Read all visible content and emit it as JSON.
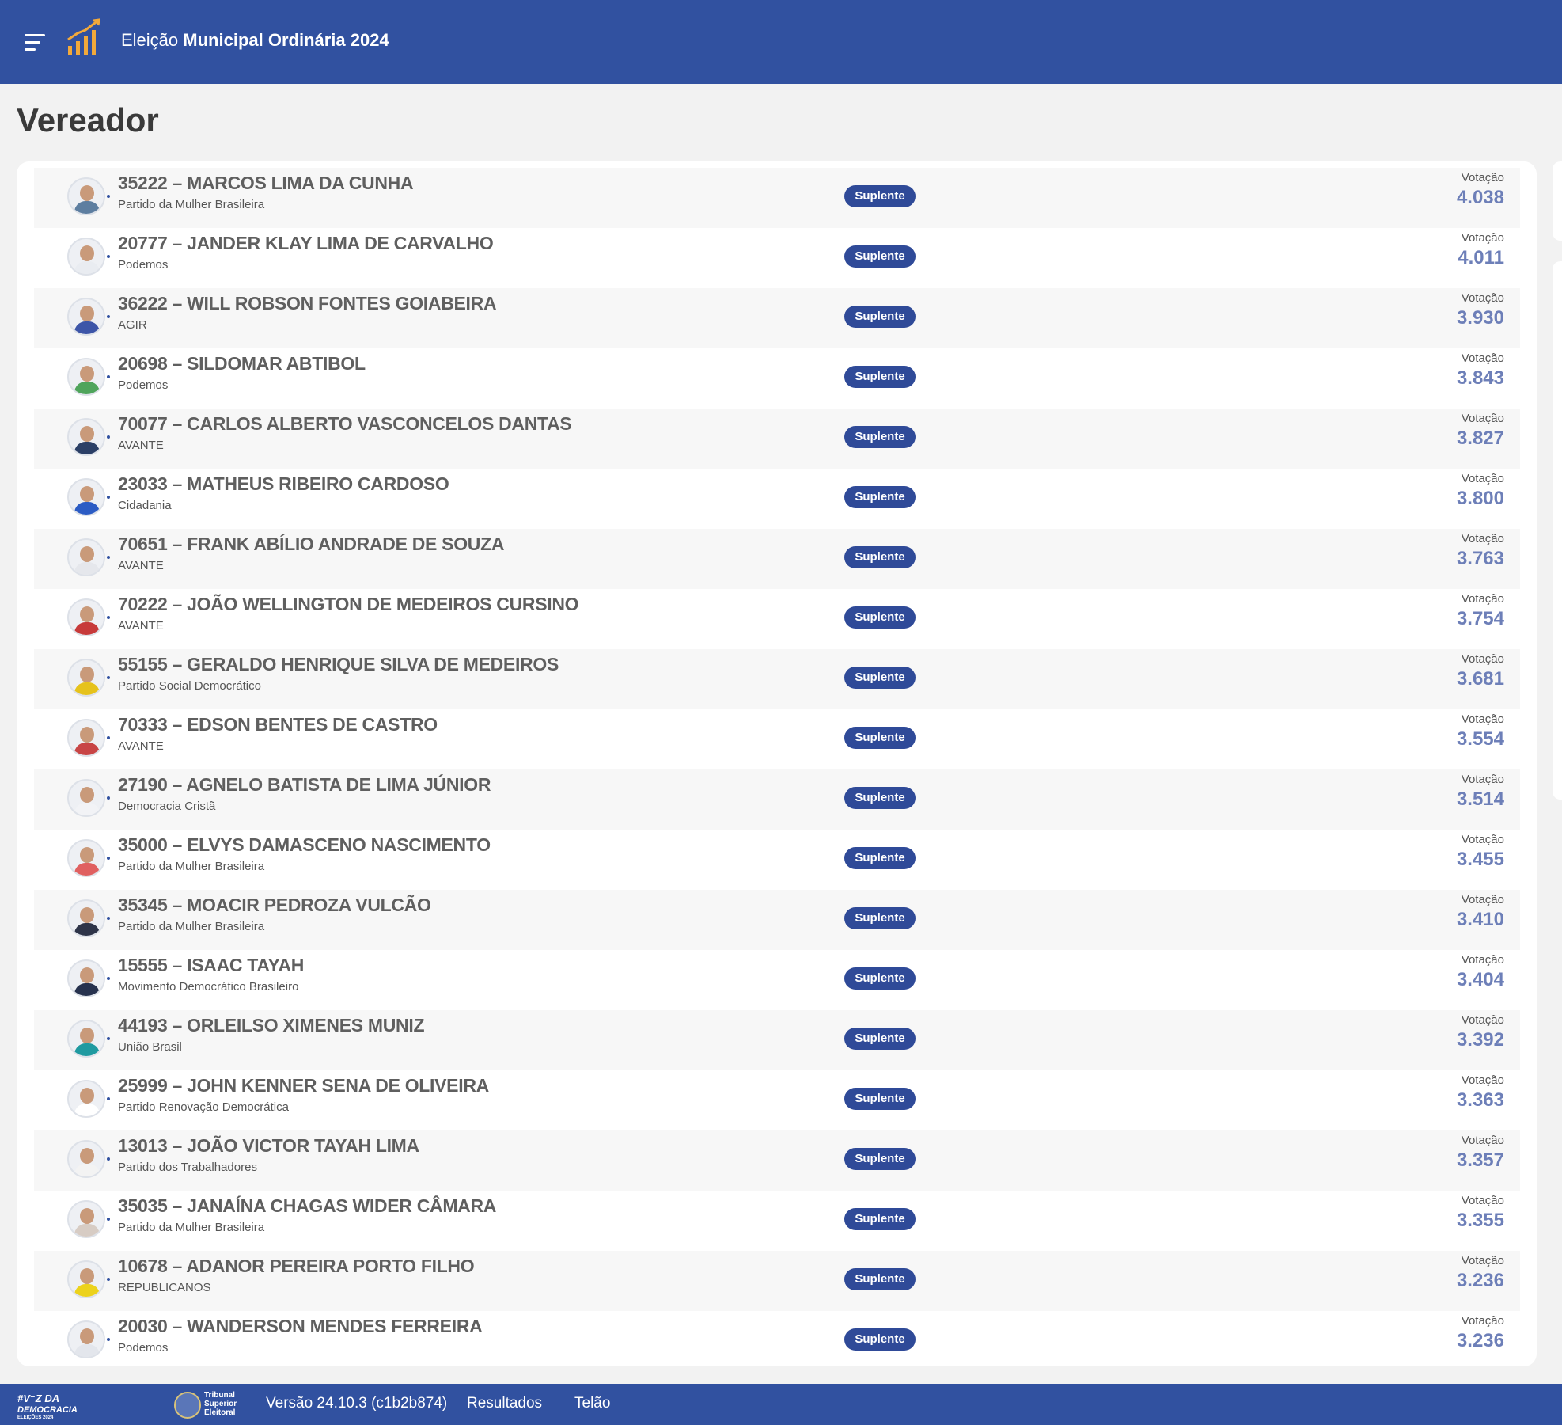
{
  "header": {
    "title_prefix": "Eleição ",
    "title_bold": "Municipal Ordinária 2024"
  },
  "page": {
    "title": "Vereador"
  },
  "vote_label": "Votação",
  "status_label": "Suplente",
  "candidates": [
    {
      "name": "35222 – MARCOS LIMA DA CUNHA",
      "party": "Partido da Mulher Brasileira",
      "votes": "4.038",
      "shirt": "#5d7ea0"
    },
    {
      "name": "20777 – JANDER KLAY LIMA DE CARVALHO",
      "party": "Podemos",
      "votes": "4.011",
      "shirt": "#e9ecf1"
    },
    {
      "name": "36222 – WILL ROBSON FONTES GOIABEIRA",
      "party": "AGIR",
      "votes": "3.930",
      "shirt": "#3d55a8"
    },
    {
      "name": "20698 – SILDOMAR ABTIBOL",
      "party": "Podemos",
      "votes": "3.843",
      "shirt": "#4fa45b"
    },
    {
      "name": "70077 – CARLOS ALBERTO VASCONCELOS DANTAS",
      "party": "AVANTE",
      "votes": "3.827",
      "shirt": "#2b3f66"
    },
    {
      "name": "23033 – MATHEUS RIBEIRO CARDOSO",
      "party": "Cidadania",
      "votes": "3.800",
      "shirt": "#2c5cc4"
    },
    {
      "name": "70651 – FRANK ABÍLIO ANDRADE DE SOUZA",
      "party": "AVANTE",
      "votes": "3.763",
      "shirt": "#e5e7ec"
    },
    {
      "name": "70222 – JOÃO WELLINGTON DE MEDEIROS CURSINO",
      "party": "AVANTE",
      "votes": "3.754",
      "shirt": "#c73a3a"
    },
    {
      "name": "55155 – GERALDO HENRIQUE SILVA DE MEDEIROS",
      "party": "Partido Social Democrático",
      "votes": "3.681",
      "shirt": "#e6c21c"
    },
    {
      "name": "70333 – EDSON BENTES DE CASTRO",
      "party": "AVANTE",
      "votes": "3.554",
      "shirt": "#c84545"
    },
    {
      "name": "27190 – AGNELO BATISTA DE LIMA JÚNIOR",
      "party": "Democracia Cristã",
      "votes": "3.514",
      "shirt": "#f2f3f6"
    },
    {
      "name": "35000 – ELVYS DAMASCENO NASCIMENTO",
      "party": "Partido da Mulher Brasileira",
      "votes": "3.455",
      "shirt": "#e06060"
    },
    {
      "name": "35345 – MOACIR PEDROZA VULCÃO",
      "party": "Partido da Mulher Brasileira",
      "votes": "3.410",
      "shirt": "#2e3448"
    },
    {
      "name": "15555 – ISAAC TAYAH",
      "party": "Movimento Democrático Brasileiro",
      "votes": "3.404",
      "shirt": "#27324e"
    },
    {
      "name": "44193 – ORLEILSO XIMENES MUNIZ",
      "party": "União Brasil",
      "votes": "3.392",
      "shirt": "#1f9aa0"
    },
    {
      "name": "25999 – JOHN KENNER SENA DE OLIVEIRA",
      "party": "Partido Renovação Democrática",
      "votes": "3.363",
      "shirt": "#ffffff"
    },
    {
      "name": "13013 – JOÃO VICTOR TAYAH LIMA",
      "party": "Partido dos Trabalhadores",
      "votes": "3.357",
      "shirt": "#f3f3f3"
    },
    {
      "name": "35035 – JANAÍNA CHAGAS WIDER CÂMARA",
      "party": "Partido da Mulher Brasileira",
      "votes": "3.355",
      "shirt": "#d7ccc4"
    },
    {
      "name": "10678 – ADANOR PEREIRA PORTO FILHO",
      "party": "REPUBLICANOS",
      "votes": "3.236",
      "shirt": "#ecd21c"
    },
    {
      "name": "20030 – WANDERSON MENDES FERREIRA",
      "party": "Podemos",
      "votes": "3.236",
      "shirt": "#e3e6ec"
    }
  ],
  "footer": {
    "logo1_line1": "#V⁻Z DA",
    "logo1_line2": "DEMOCRACIA",
    "logo1_line3": "ELEIÇÕES 2024",
    "logo2_line1": "Tribunal",
    "logo2_line2": "Superior",
    "logo2_line3": "Eleitoral",
    "version": "Versão 24.10.3 (c1b2b874)",
    "link_results": "Resultados",
    "link_screen": "Telão"
  },
  "colors": {
    "brand_blue": "#3151a0",
    "badge_blue": "#2f4a98",
    "votes_blue": "#6d7fb8",
    "logo_orange": "#f2a93b"
  }
}
